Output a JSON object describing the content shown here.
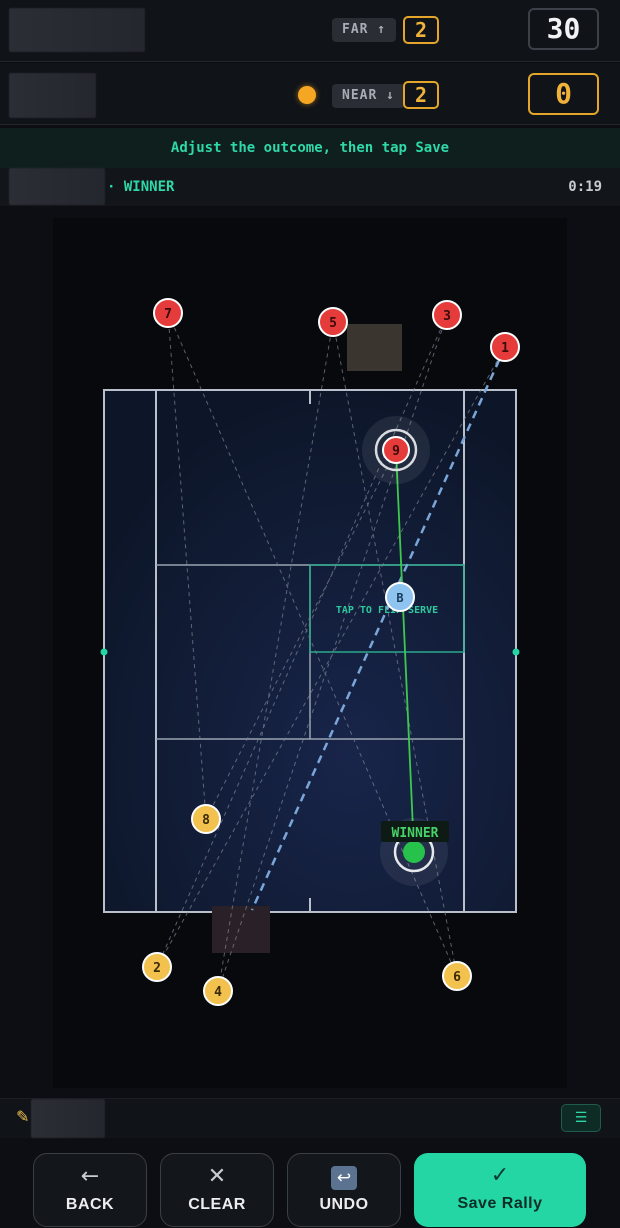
{
  "scoreboard": {
    "far": {
      "tag": "FAR ↑",
      "games": "2",
      "points": "30"
    },
    "near": {
      "tag": "NEAR ↓",
      "games": "2",
      "points": "0"
    }
  },
  "instruction": "Adjust the outcome, then tap Save",
  "status": {
    "outcome": "· WINNER",
    "time": "0:19"
  },
  "court": {
    "serve_hint": "TAP TO FLIP SERVE",
    "ball_marker": "B",
    "winner_label": "WINNER",
    "shots": [
      {
        "n": "1",
        "color": "red"
      },
      {
        "n": "2",
        "color": "yellow"
      },
      {
        "n": "3",
        "color": "red"
      },
      {
        "n": "4",
        "color": "yellow"
      },
      {
        "n": "5",
        "color": "red"
      },
      {
        "n": "6",
        "color": "yellow"
      },
      {
        "n": "7",
        "color": "red"
      },
      {
        "n": "8",
        "color": "yellow"
      },
      {
        "n": "9",
        "color": "red"
      }
    ]
  },
  "colors": {
    "accent": "#23d6a4",
    "far_shot": "#e53b3b",
    "near_shot": "#f2c14e",
    "games_border": "#e3a52a",
    "winner_dot": "#27c24c"
  },
  "icons": {
    "back": "arrow-left-icon",
    "clear": "close-icon",
    "undo": "undo-icon",
    "save": "check-icon",
    "settings": "sliders-icon",
    "racket": "racket-icon"
  },
  "toolbar": {
    "back_label": "BACK",
    "clear_label": "CLEAR",
    "undo_label": "UNDO",
    "save_label": "Save Rally"
  }
}
